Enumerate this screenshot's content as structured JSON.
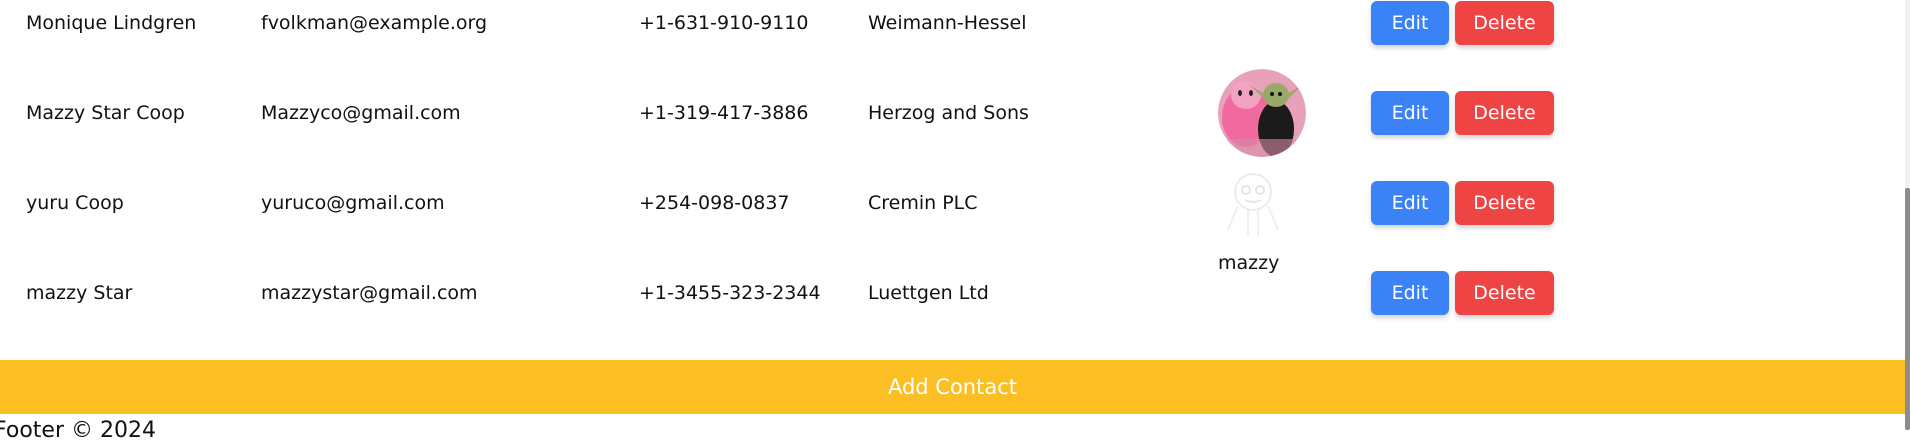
{
  "contacts": [
    {
      "name": "Monique Lindgren",
      "email": "fvolkman@example.org",
      "phone": "+1-631-910-9110",
      "company": "Weimann-Hessel"
    },
    {
      "name": "Mazzy Star Coop",
      "email": "Mazzyco@gmail.com",
      "phone": "+1-319-417-3886",
      "company": "Herzog and Sons"
    },
    {
      "name": "yuru Coop",
      "email": "yuruco@gmail.com",
      "phone": "+254-098-0837",
      "company": "Cremin PLC"
    },
    {
      "name": "mazzy Star",
      "email": "mazzystar@gmail.com",
      "phone": "+1-3455-323-2344",
      "company": "Luettgen Ltd"
    }
  ],
  "avatar_broken_alt": "mazzy",
  "buttons": {
    "edit": "Edit",
    "delete": "Delete"
  },
  "add_contact_label": "Add Contact",
  "footer_text": "Footer © 2024",
  "colors": {
    "edit": "#3b82f6",
    "delete": "#ef4444",
    "add_bar": "#fbbf24"
  },
  "icons": {
    "ghost": "ghost-avatar-icon",
    "photo": "plush-toys-avatar"
  }
}
